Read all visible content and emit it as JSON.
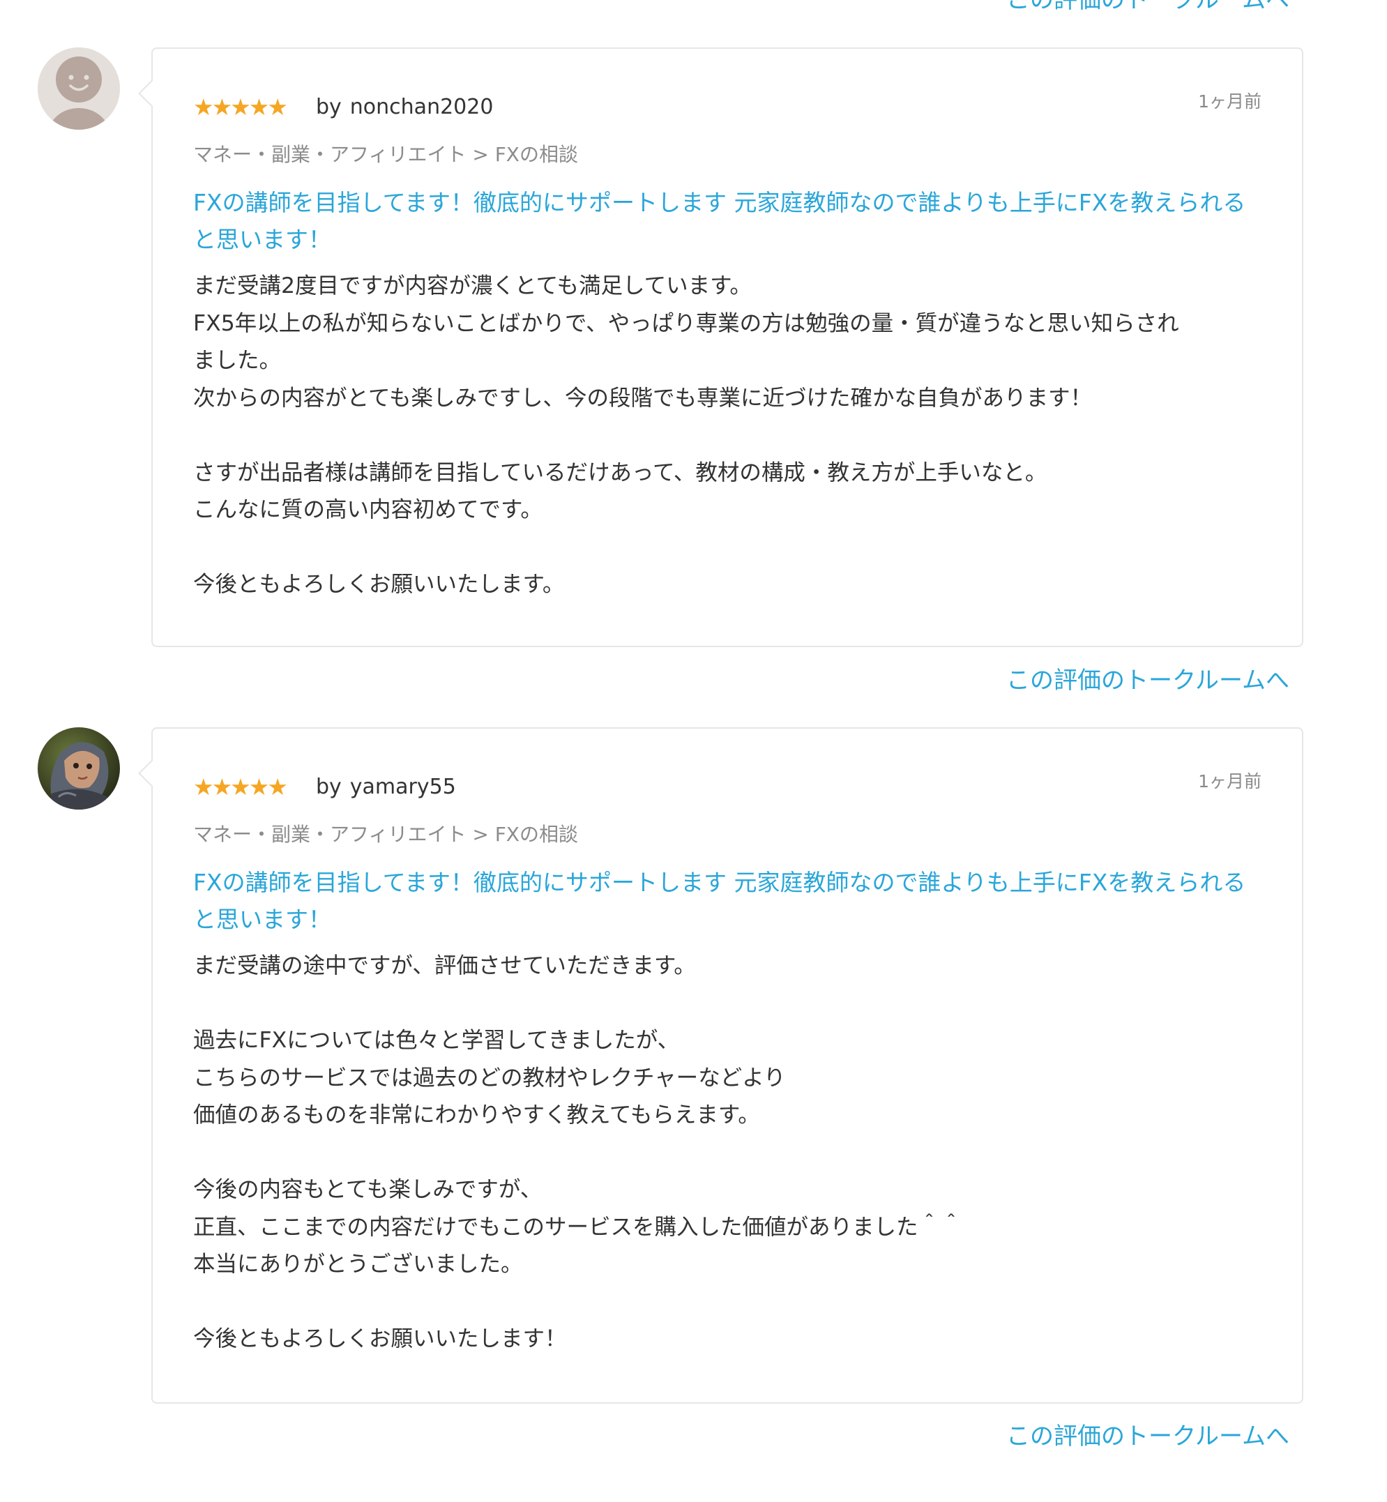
{
  "top_talk_link": "この評価のトークルームへ",
  "reviews": [
    {
      "avatar": "default-avatar-icon",
      "rating": 5,
      "stars": "★★★★★",
      "by_label": "by",
      "username": "nonchan2020",
      "time_ago": "1ヶ月前",
      "category": "マネー・副業・アフィリエイト > FXの相談",
      "service_title": "FXの講師を目指してます！徹底的にサポートします 元家庭教師なので誰よりも上手にFXを教えられると思います！",
      "comment_lines": [
        "まだ受講2度目ですが内容が濃くとても満足しています。",
        "FX5年以上の私が知らないことばかりで、やっぱり専業の方は勉強の量・質が違うなと思い知らされ",
        "ました。",
        "次からの内容がとても楽しみですし、今の段階でも専業に近づけた確かな自負があります！",
        "",
        "さすが出品者様は講師を目指しているだけあって、教材の構成・教え方が上手いなと。",
        "こんなに質の高い内容初めてです。",
        "",
        "今後ともよろしくお願いいたします。"
      ],
      "talk_link": "この評価のトークルームへ"
    },
    {
      "avatar": "user-photo-avatar",
      "rating": 5,
      "stars": "★★★★★",
      "by_label": "by",
      "username": "yamary55",
      "time_ago": "1ヶ月前",
      "category": "マネー・副業・アフィリエイト > FXの相談",
      "service_title": "FXの講師を目指してます！徹底的にサポートします 元家庭教師なので誰よりも上手にFXを教えられると思います！",
      "comment_lines": [
        "まだ受講の途中ですが、評価させていただきます。",
        "",
        "過去にFXについては色々と学習してきましたが、",
        "こちらのサービスでは過去のどの教材やレクチャーなどより",
        "価値のあるものを非常にわかりやすく教えてもらえます。",
        "",
        "今後の内容もとても楽しみですが、",
        "正直、ここまでの内容だけでもこのサービスを購入した価値がありました＾＾",
        "本当にありがとうございました。",
        "",
        "今後ともよろしくお願いいたします！"
      ],
      "talk_link": "この評価のトークルームへ"
    }
  ],
  "colors": {
    "link": "#2aa6d9",
    "star": "#f5a623",
    "meta_text": "#8c8c8c",
    "body_text": "#333333",
    "card_border": "#e6e6e6"
  }
}
